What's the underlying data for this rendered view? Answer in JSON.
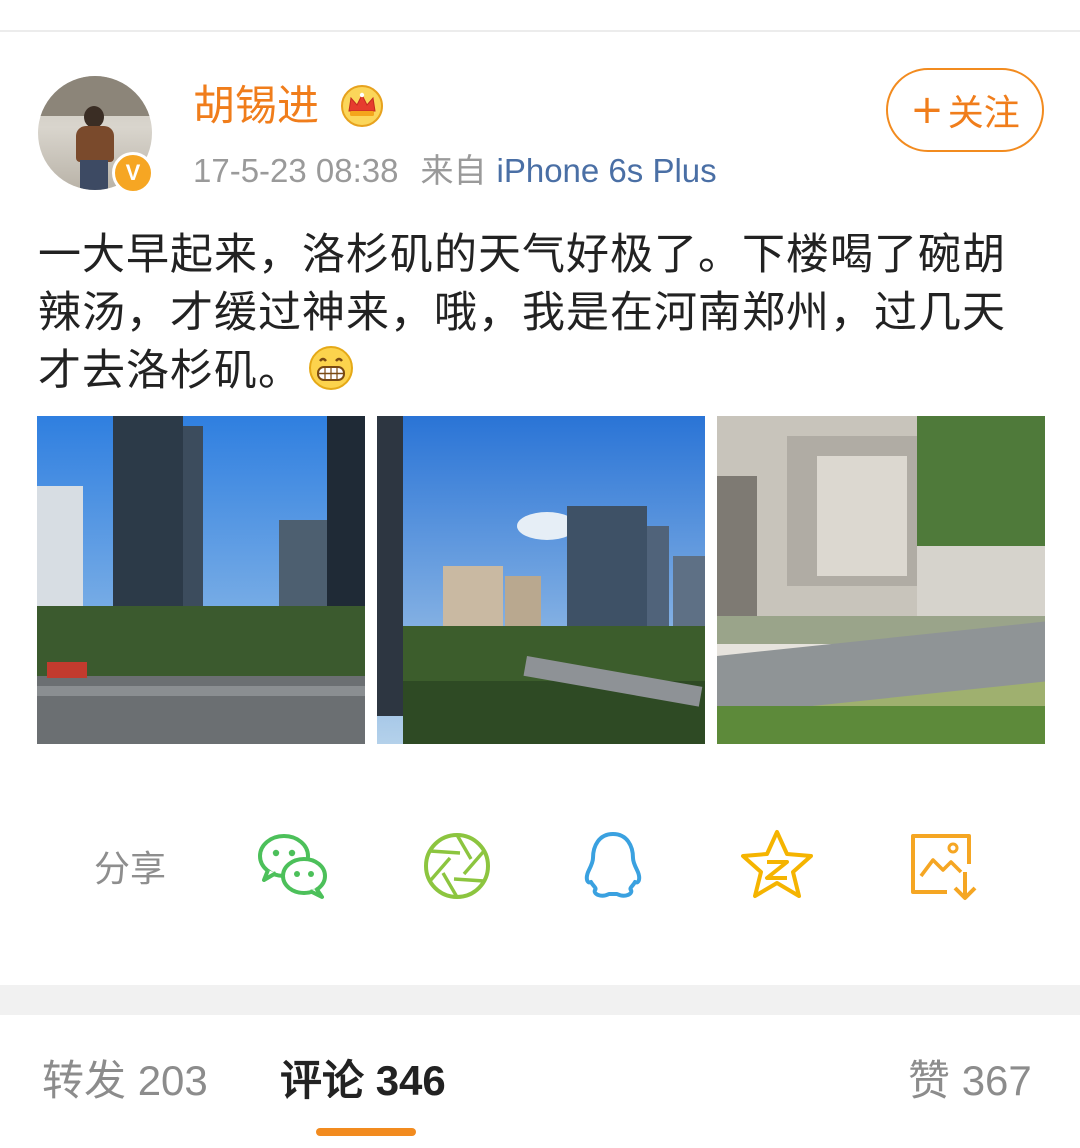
{
  "post": {
    "author": {
      "name": "胡锡进",
      "avatar_icon": "profile-photo",
      "verified_icon": "verified-badge-icon",
      "vip_icon": "crown-icon"
    },
    "timestamp": "17-5-23 08:38",
    "source_label": "来自",
    "source_device": "iPhone 6s Plus",
    "follow_button": {
      "plus": "+",
      "label": "关注"
    },
    "text": "一大早起来，洛杉矶的天气好极了。下楼喝了碗胡辣汤，才缓过神来，哦，我是在河南郑州，过几天才去洛杉矶。",
    "emoji": "grin-emoji",
    "photos": [
      "city-skyline-photo",
      "city-skyline-photo",
      "street-view-photo"
    ]
  },
  "share": {
    "label": "分享",
    "targets": [
      {
        "name": "wechat-icon",
        "color": "#4cc05a"
      },
      {
        "name": "wechat-moments-icon",
        "color": "#8cc53f"
      },
      {
        "name": "qq-icon",
        "color": "#3aa1e0"
      },
      {
        "name": "qzone-icon",
        "color": "#f5b400"
      },
      {
        "name": "save-image-icon",
        "color": "#f5a623"
      }
    ]
  },
  "tabs": {
    "repost": {
      "label": "转发",
      "count": "203"
    },
    "comments": {
      "label": "评论",
      "count": "346"
    },
    "likes": {
      "label": "赞",
      "count": "367"
    }
  },
  "colors": {
    "accent": "#f28b1f",
    "username": "#f07d1b",
    "link": "#4a6fa5"
  }
}
